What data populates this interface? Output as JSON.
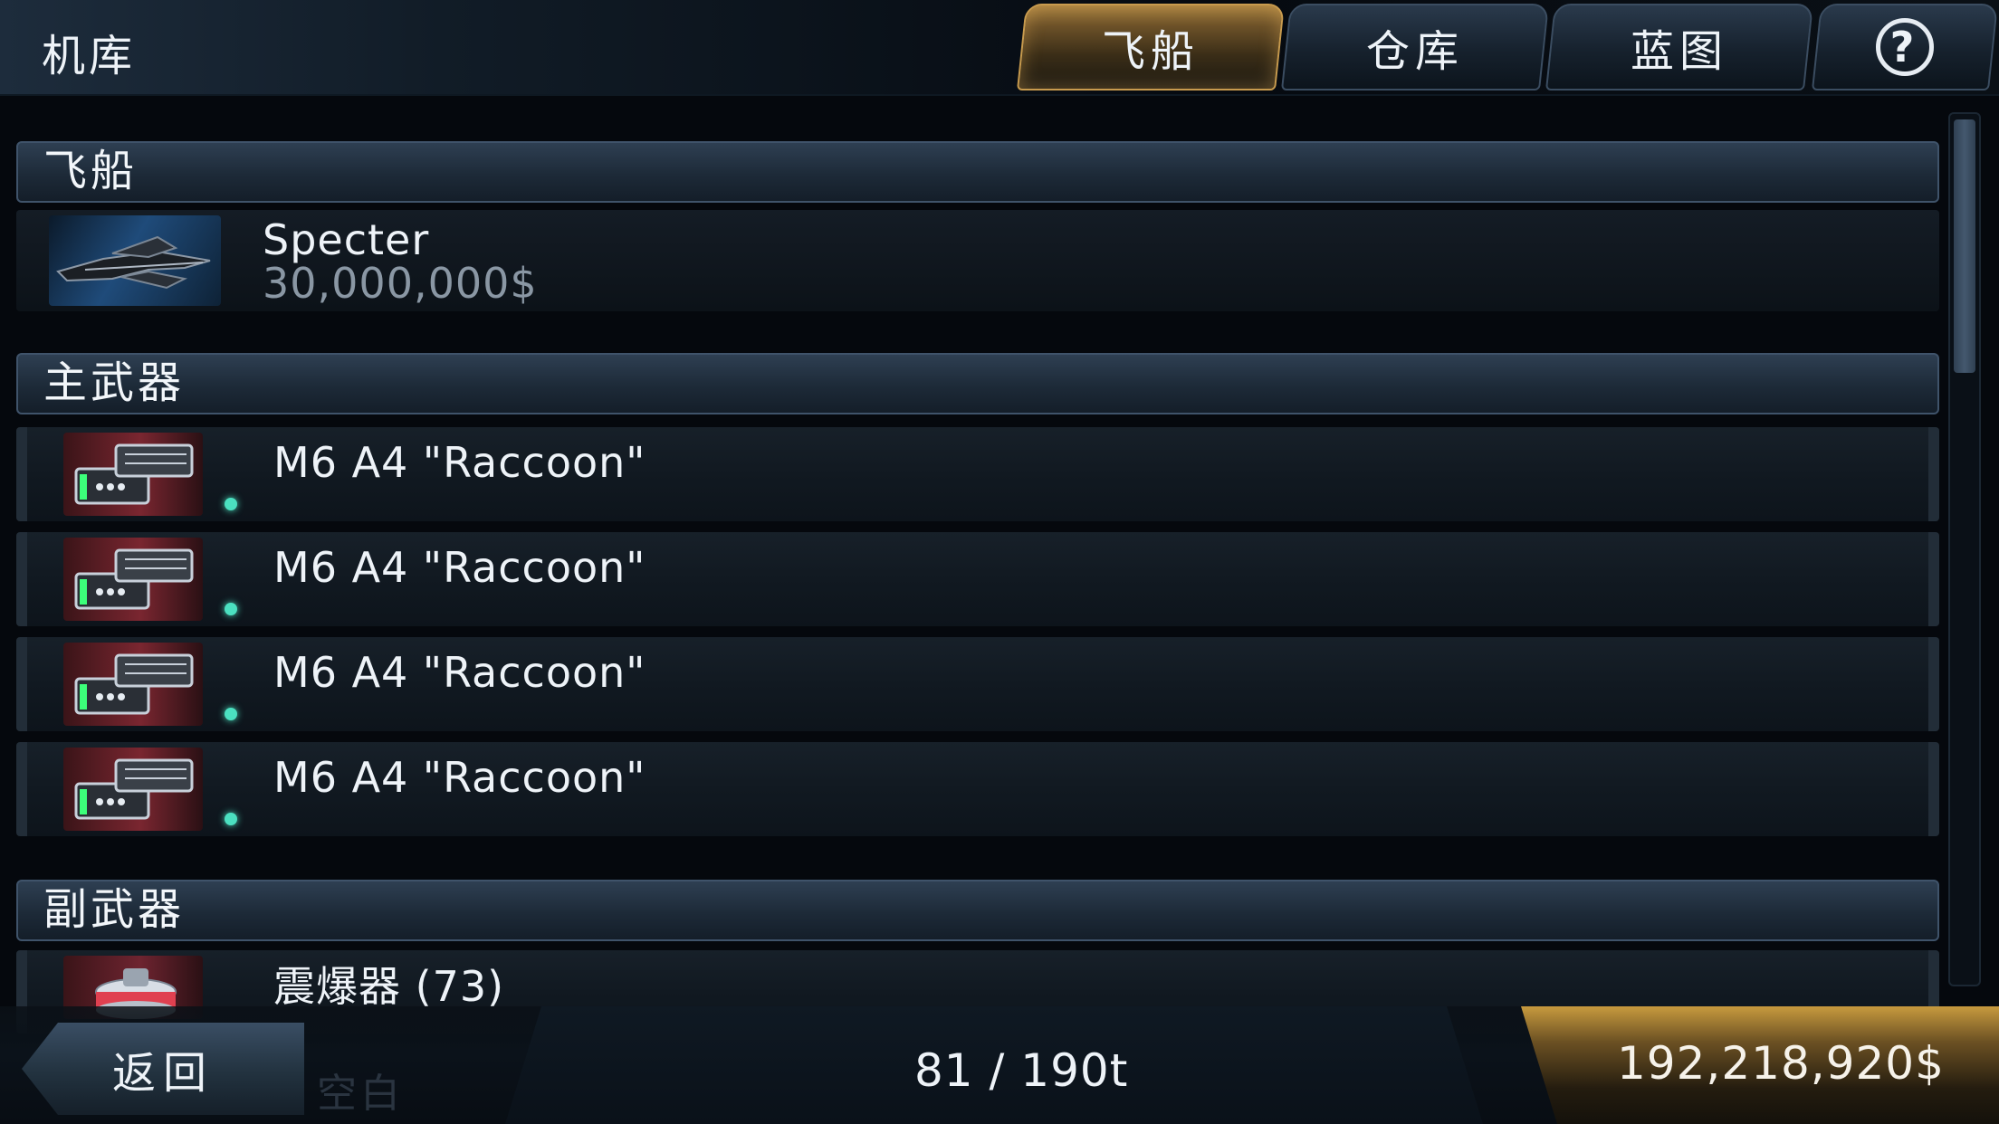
{
  "header": {
    "title": "机库",
    "tabs": [
      {
        "label": "飞船",
        "active": true
      },
      {
        "label": "仓库",
        "active": false
      },
      {
        "label": "蓝图",
        "active": false
      }
    ],
    "help_icon": "question-circle-icon"
  },
  "sections": {
    "ship": {
      "title": "飞船",
      "item": {
        "name": "Specter",
        "price": "30,000,000$"
      }
    },
    "primary": {
      "title": "主武器",
      "items": [
        {
          "name": "M6 A4 \"Raccoon\""
        },
        {
          "name": "M6 A4 \"Raccoon\""
        },
        {
          "name": "M6 A4 \"Raccoon\""
        },
        {
          "name": "M6 A4 \"Raccoon\""
        }
      ]
    },
    "secondary": {
      "title": "副武器",
      "items": [
        {
          "name": "震爆器 (73)"
        }
      ]
    }
  },
  "footer": {
    "back_label": "返回",
    "ghost_label": "空白",
    "capacity": "81 / 190t",
    "money": "192,218,920$"
  },
  "colors": {
    "active_tab": "#c89b4e",
    "status_dot": "#4be0c0",
    "money_gold": "#c79a3e"
  }
}
